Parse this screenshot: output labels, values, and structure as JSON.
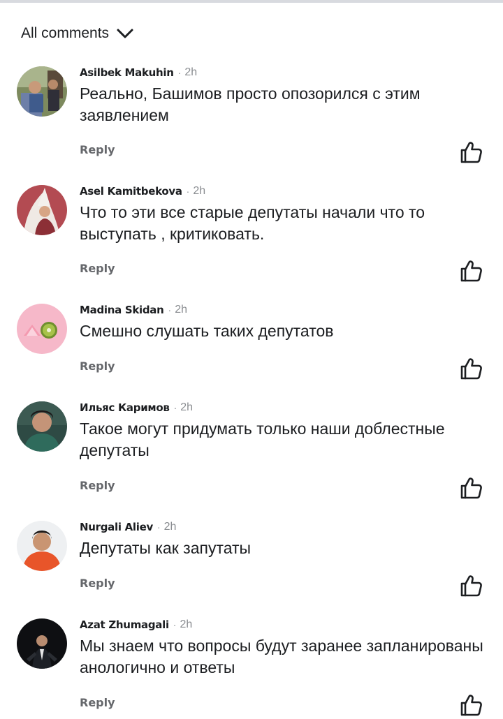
{
  "header": {
    "filter_label": "All comments",
    "filter_icon": "chevron-down-icon"
  },
  "comments": [
    {
      "author": "Asilbek Makuhin",
      "separator": "·",
      "time": "2h",
      "text": "Реально, Башимов просто опозорился с этим заявлением",
      "reply_label": "Reply",
      "like_icon": "thumbs-up-icon"
    },
    {
      "author": "Asel Kamitbekova",
      "separator": "·",
      "time": "2h",
      "text": "Что то эти все старые депутаты начали что то выступать , критиковать.",
      "reply_label": "Reply",
      "like_icon": "thumbs-up-icon"
    },
    {
      "author": "Madina Skidan",
      "separator": "·",
      "time": "2h",
      "text": "Смешно слушать таких депутатов",
      "reply_label": "Reply",
      "like_icon": "thumbs-up-icon"
    },
    {
      "author": "Ильяс Каримов",
      "separator": "·",
      "time": "2h",
      "text": "Такое могут придумать только наши доблестные депутаты",
      "reply_label": "Reply",
      "like_icon": "thumbs-up-icon"
    },
    {
      "author": "Nurgali Aliev",
      "separator": "·",
      "time": "2h",
      "text": "Депутаты как запутаты",
      "reply_label": "Reply",
      "like_icon": "thumbs-up-icon"
    },
    {
      "author": "Azat Zhumagali",
      "separator": "·",
      "time": "2h",
      "text": "Мы знаем что вопросы будут заранее запланированы  анологично и ответы",
      "reply_label": "Reply",
      "like_icon": "thumbs-up-icon"
    }
  ],
  "colors": {
    "text_primary": "#1c1e21",
    "text_secondary": "#65676b",
    "timestamp": "#8a8d91",
    "background": "#ffffff"
  }
}
